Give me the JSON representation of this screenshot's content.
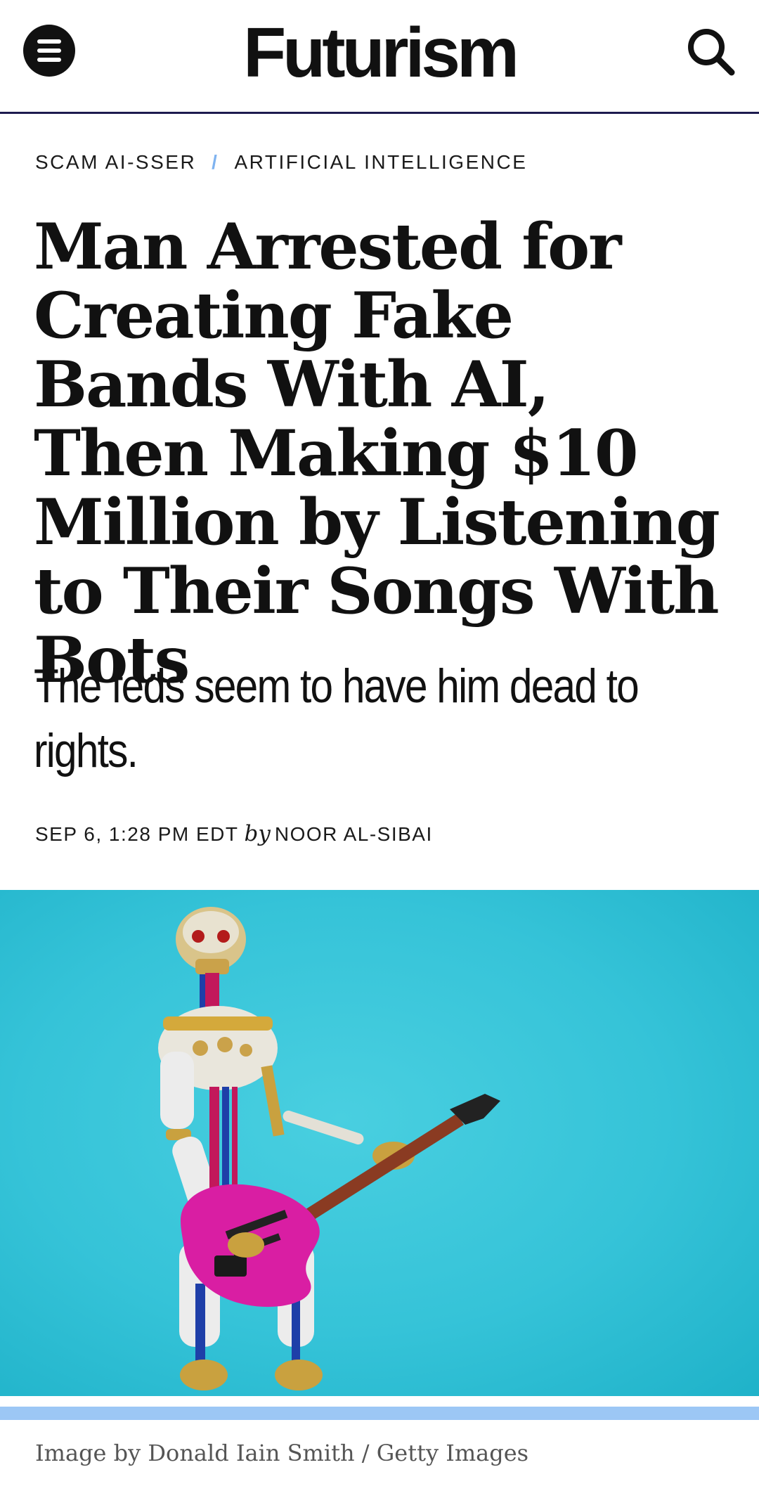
{
  "header": {
    "logo_text": "Futurism",
    "menu_icon": "hamburger-menu-icon",
    "search_icon": "search-icon"
  },
  "breadcrumb": {
    "items": [
      "SCAM AI-SSER",
      "ARTIFICIAL INTELLIGENCE"
    ],
    "separator": "/"
  },
  "article": {
    "headline": "Man Arrested for Creating Fake Bands With AI, Then Making $10 Million by Listening to Their Songs With Bots",
    "subtitle": "The feds seem to have him dead to rights.",
    "date": "SEP 6, 1:28 PM EDT",
    "by_word": "by",
    "author": "NOOR AL-SIBAI"
  },
  "hero_image": {
    "alt": "Robot skeleton playing a pink electric guitar",
    "caption": "Image by Donald Iain Smith / Getty Images"
  },
  "colors": {
    "accent_separator": "#7fb3f0",
    "header_rule": "#1d1b4f",
    "image_background": "#35c3d8",
    "accent_strip": "#9cc7f5",
    "guitar": "#d91ea3"
  }
}
